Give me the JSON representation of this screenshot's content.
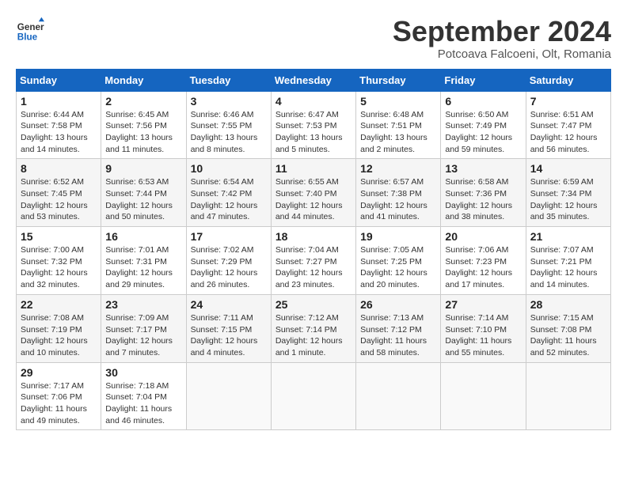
{
  "header": {
    "logo_line1": "General",
    "logo_line2": "Blue",
    "month_title": "September 2024",
    "location": "Potcoava Falcoeni, Olt, Romania"
  },
  "weekdays": [
    "Sunday",
    "Monday",
    "Tuesday",
    "Wednesday",
    "Thursday",
    "Friday",
    "Saturday"
  ],
  "weeks": [
    [
      {
        "day": "1",
        "text": "Sunrise: 6:44 AM\nSunset: 7:58 PM\nDaylight: 13 hours and 14 minutes."
      },
      {
        "day": "2",
        "text": "Sunrise: 6:45 AM\nSunset: 7:56 PM\nDaylight: 13 hours and 11 minutes."
      },
      {
        "day": "3",
        "text": "Sunrise: 6:46 AM\nSunset: 7:55 PM\nDaylight: 13 hours and 8 minutes."
      },
      {
        "day": "4",
        "text": "Sunrise: 6:47 AM\nSunset: 7:53 PM\nDaylight: 13 hours and 5 minutes."
      },
      {
        "day": "5",
        "text": "Sunrise: 6:48 AM\nSunset: 7:51 PM\nDaylight: 13 hours and 2 minutes."
      },
      {
        "day": "6",
        "text": "Sunrise: 6:50 AM\nSunset: 7:49 PM\nDaylight: 12 hours and 59 minutes."
      },
      {
        "day": "7",
        "text": "Sunrise: 6:51 AM\nSunset: 7:47 PM\nDaylight: 12 hours and 56 minutes."
      }
    ],
    [
      {
        "day": "8",
        "text": "Sunrise: 6:52 AM\nSunset: 7:45 PM\nDaylight: 12 hours and 53 minutes."
      },
      {
        "day": "9",
        "text": "Sunrise: 6:53 AM\nSunset: 7:44 PM\nDaylight: 12 hours and 50 minutes."
      },
      {
        "day": "10",
        "text": "Sunrise: 6:54 AM\nSunset: 7:42 PM\nDaylight: 12 hours and 47 minutes."
      },
      {
        "day": "11",
        "text": "Sunrise: 6:55 AM\nSunset: 7:40 PM\nDaylight: 12 hours and 44 minutes."
      },
      {
        "day": "12",
        "text": "Sunrise: 6:57 AM\nSunset: 7:38 PM\nDaylight: 12 hours and 41 minutes."
      },
      {
        "day": "13",
        "text": "Sunrise: 6:58 AM\nSunset: 7:36 PM\nDaylight: 12 hours and 38 minutes."
      },
      {
        "day": "14",
        "text": "Sunrise: 6:59 AM\nSunset: 7:34 PM\nDaylight: 12 hours and 35 minutes."
      }
    ],
    [
      {
        "day": "15",
        "text": "Sunrise: 7:00 AM\nSunset: 7:32 PM\nDaylight: 12 hours and 32 minutes."
      },
      {
        "day": "16",
        "text": "Sunrise: 7:01 AM\nSunset: 7:31 PM\nDaylight: 12 hours and 29 minutes."
      },
      {
        "day": "17",
        "text": "Sunrise: 7:02 AM\nSunset: 7:29 PM\nDaylight: 12 hours and 26 minutes."
      },
      {
        "day": "18",
        "text": "Sunrise: 7:04 AM\nSunset: 7:27 PM\nDaylight: 12 hours and 23 minutes."
      },
      {
        "day": "19",
        "text": "Sunrise: 7:05 AM\nSunset: 7:25 PM\nDaylight: 12 hours and 20 minutes."
      },
      {
        "day": "20",
        "text": "Sunrise: 7:06 AM\nSunset: 7:23 PM\nDaylight: 12 hours and 17 minutes."
      },
      {
        "day": "21",
        "text": "Sunrise: 7:07 AM\nSunset: 7:21 PM\nDaylight: 12 hours and 14 minutes."
      }
    ],
    [
      {
        "day": "22",
        "text": "Sunrise: 7:08 AM\nSunset: 7:19 PM\nDaylight: 12 hours and 10 minutes."
      },
      {
        "day": "23",
        "text": "Sunrise: 7:09 AM\nSunset: 7:17 PM\nDaylight: 12 hours and 7 minutes."
      },
      {
        "day": "24",
        "text": "Sunrise: 7:11 AM\nSunset: 7:15 PM\nDaylight: 12 hours and 4 minutes."
      },
      {
        "day": "25",
        "text": "Sunrise: 7:12 AM\nSunset: 7:14 PM\nDaylight: 12 hours and 1 minute."
      },
      {
        "day": "26",
        "text": "Sunrise: 7:13 AM\nSunset: 7:12 PM\nDaylight: 11 hours and 58 minutes."
      },
      {
        "day": "27",
        "text": "Sunrise: 7:14 AM\nSunset: 7:10 PM\nDaylight: 11 hours and 55 minutes."
      },
      {
        "day": "28",
        "text": "Sunrise: 7:15 AM\nSunset: 7:08 PM\nDaylight: 11 hours and 52 minutes."
      }
    ],
    [
      {
        "day": "29",
        "text": "Sunrise: 7:17 AM\nSunset: 7:06 PM\nDaylight: 11 hours and 49 minutes."
      },
      {
        "day": "30",
        "text": "Sunrise: 7:18 AM\nSunset: 7:04 PM\nDaylight: 11 hours and 46 minutes."
      },
      {
        "day": "",
        "text": ""
      },
      {
        "day": "",
        "text": ""
      },
      {
        "day": "",
        "text": ""
      },
      {
        "day": "",
        "text": ""
      },
      {
        "day": "",
        "text": ""
      }
    ]
  ]
}
